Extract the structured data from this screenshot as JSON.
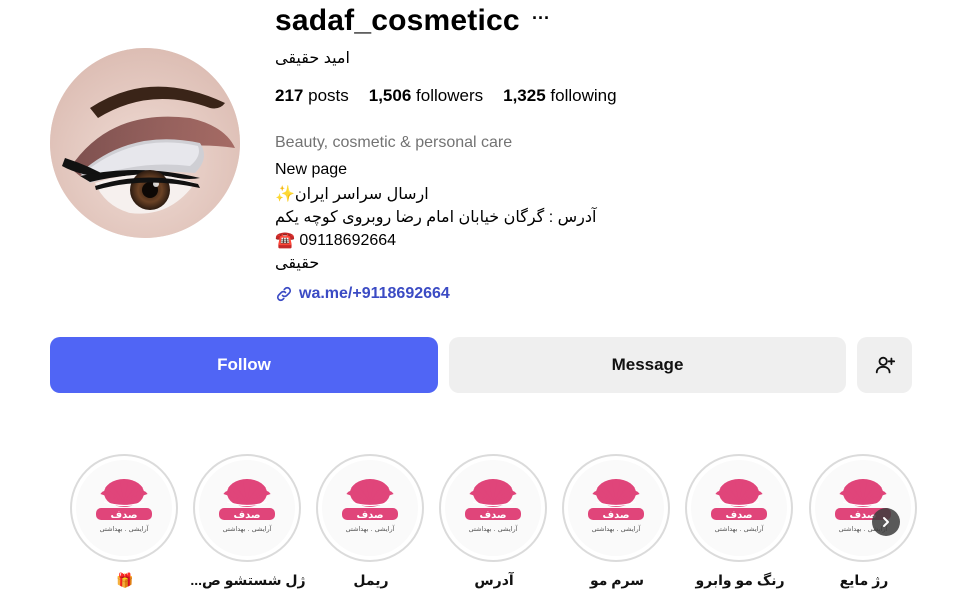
{
  "profile": {
    "username": "sadaf_cosmeticc",
    "more_label": "···",
    "full_name": "امید حقیقی",
    "stats": {
      "posts_count": "217",
      "posts_label": "posts",
      "followers_count": "1,506",
      "followers_label": "followers",
      "following_count": "1,325",
      "following_label": "following"
    },
    "category": "Beauty, cosmetic & personal care",
    "bio": [
      "New page",
      "ارسال سراسر ایران✨",
      "آدرس : گرگان خیابان امام رضا روبروی کوچه یکم",
      "☎️ 09118692664",
      "حقیقی"
    ],
    "link": "wa.me/+9118692664"
  },
  "actions": {
    "follow": "Follow",
    "message": "Message"
  },
  "highlights": [
    {
      "label": "رژ مایع"
    },
    {
      "label": "رنگ مو وابرو"
    },
    {
      "label": "سرم مو"
    },
    {
      "label": "آدرس"
    },
    {
      "label": "ریمل"
    },
    {
      "label": "ژل شستشو ص..."
    },
    {
      "label": "🎁"
    }
  ],
  "logo_text": {
    "main": "صدف",
    "tagline": "آرایشی . بهداشتی"
  },
  "colors": {
    "accent": "#5065f5",
    "logo_pink": "#e0457a",
    "link": "#3b4bc4",
    "muted": "#737373",
    "button_gray": "#efefef"
  }
}
